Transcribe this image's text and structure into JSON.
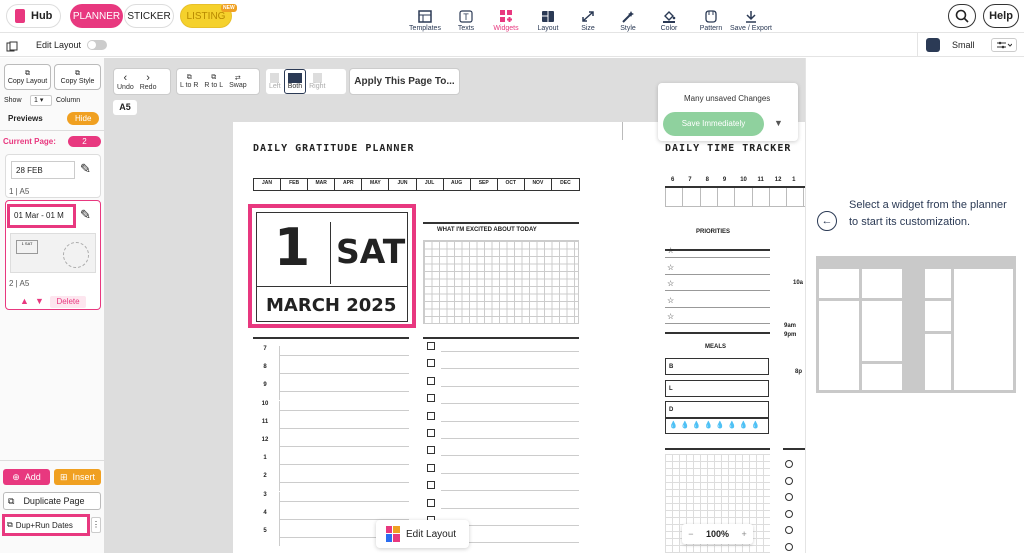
{
  "top": {
    "hub": "Hub",
    "tabs": {
      "planner": "PLANNER",
      "sticker": "STICKER",
      "listing": "LISTING",
      "new": "NEW"
    },
    "tools": [
      "Templates",
      "Texts",
      "Widgets",
      "Layout",
      "Size",
      "Style",
      "Color",
      "Pattern",
      "Save / Export"
    ],
    "help": "Help"
  },
  "row2": {
    "edit_layout": "Edit Layout",
    "size": "Small"
  },
  "left": {
    "copy_layout": "Copy Layout",
    "copy_style": "Copy Style",
    "show": "Show",
    "show_count": "1",
    "column": "Column",
    "previews": "Previews",
    "hide": "Hide",
    "current_page": "Current Page:",
    "current_page_num": "2",
    "page1_date": "28 FEB",
    "page1_label": "1 | A5",
    "page2_date": "01 Mar - 01 M",
    "page2_label": "2 | A5",
    "delete": "Delete",
    "add": "Add",
    "insert": "Insert",
    "duplicate": "Duplicate Page",
    "duprun": "Dup+Run Dates"
  },
  "canvas": {
    "undo": "Undo",
    "redo": "Redo",
    "ltor": "L to R",
    "rtol": "R to L",
    "swap": "Swap",
    "left": "Left",
    "both": "Both",
    "right": "Right",
    "apply": "Apply This Page To...",
    "size": "A5",
    "unsaved": "Many unsaved Changes",
    "save": "Save Immediately",
    "zoom": "100%",
    "edit_layout": "Edit Layout"
  },
  "planner": {
    "title": "DAILY GRATITUDE PLANNER",
    "months": [
      "JAN",
      "FEB",
      "MAR",
      "APR",
      "MAY",
      "JUN",
      "JUL",
      "AUG",
      "SEP",
      "OCT",
      "NOV",
      "DEC"
    ],
    "day_num": "1",
    "day_name": "SAT",
    "month_year": "MARCH 2025",
    "excited": "WHAT I'M EXCITED ABOUT TODAY",
    "hours": [
      "7",
      "8",
      "9",
      "10",
      "11",
      "12",
      "1",
      "2",
      "3",
      "4",
      "5"
    ],
    "time_title": "DAILY TIME TRACKER",
    "time_hours": [
      "6",
      "7",
      "8",
      "9",
      "10",
      "11",
      "12",
      "1"
    ],
    "priorities": "PRIORITIES",
    "meals": "MEALS",
    "meal_letters": [
      "B",
      "L",
      "D"
    ],
    "side_labels": [
      "10a",
      "9am",
      "9pm",
      "8p"
    ]
  },
  "right": {
    "message": "Select a widget from the planner to start its customization."
  },
  "colors": {
    "accent": "#e8387f",
    "listing": "#f5d12c",
    "orange": "#f0a021",
    "green": "#8fd19e"
  }
}
